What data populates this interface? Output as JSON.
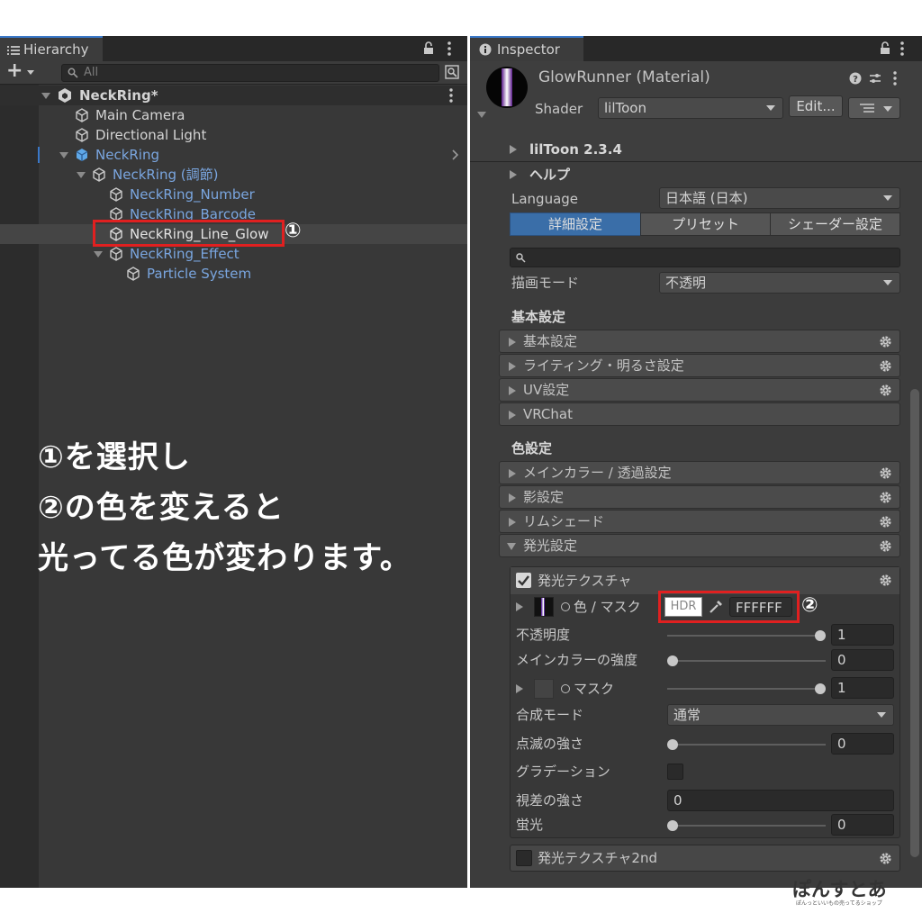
{
  "hierarchy": {
    "tab_title": "Hierarchy",
    "search_placeholder": "All",
    "add_label": "+",
    "scene_name": "NeckRing*",
    "items": [
      {
        "label": "Main Camera"
      },
      {
        "label": "Directional Light"
      },
      {
        "label": "NeckRing"
      },
      {
        "label": "NeckRing (調節)"
      },
      {
        "label": "NeckRing_Number"
      },
      {
        "label": "NeckRing_Barcode"
      },
      {
        "label": "NeckRing_Line_Glow"
      },
      {
        "label": "NeckRing_Effect"
      },
      {
        "label": "Particle System"
      }
    ]
  },
  "annotations": {
    "marker1": "①",
    "marker2": "②",
    "line1": "①を選択し",
    "line2": "②の色を変えると",
    "line3": "光ってる色が変わります。"
  },
  "inspector": {
    "tab_title": "Inspector",
    "material_name": "GlowRunner (Material)",
    "shader_label": "Shader",
    "shader_value": "lilToon",
    "edit_button": "Edit...",
    "version": "lilToon 2.3.4",
    "help": "ヘルプ",
    "language_label": "Language",
    "language_value": "日本語 (日本)",
    "tabs": [
      "詳細設定",
      "プリセット",
      "シェーダー設定"
    ],
    "render_mode_label": "描画モード",
    "render_mode_value": "不透明",
    "basic_header": "基本設定",
    "basic_sections": [
      "基本設定",
      "ライティング・明るさ設定",
      "UV設定",
      "VRChat"
    ],
    "color_header": "色設定",
    "color_sections": [
      "メインカラー / 透過設定",
      "影設定",
      "リムシェード",
      "発光設定"
    ],
    "emission": {
      "texture_label": "発光テクスチャ",
      "color_mask_label": "色 / マスク",
      "hdr_label": "HDR",
      "color_hex": "FFFFFF",
      "opacity_label": "不透明度",
      "opacity_value": "1",
      "main_color_strength_label": "メインカラーの強度",
      "main_color_strength_value": "0",
      "mask_label": "マスク",
      "mask_value": "1",
      "blend_mode_label": "合成モード",
      "blend_mode_value": "通常",
      "blink_label": "点滅の強さ",
      "blink_value": "0",
      "gradation_label": "グラデーション",
      "parallax_label": "視差の強さ",
      "parallax_value": "0",
      "fluorescence_label": "蛍光",
      "fluorescence_value": "0",
      "texture2_label": "発光テクスチャ2nd"
    }
  },
  "watermark": {
    "title": "ぽんすとあ",
    "subtitle": "ぽんっといいもの売ってるショップ"
  },
  "colors": {
    "accent_blue": "#3a78c8",
    "prefab_blue": "#7aa6e0",
    "marker_red": "#e02020"
  }
}
